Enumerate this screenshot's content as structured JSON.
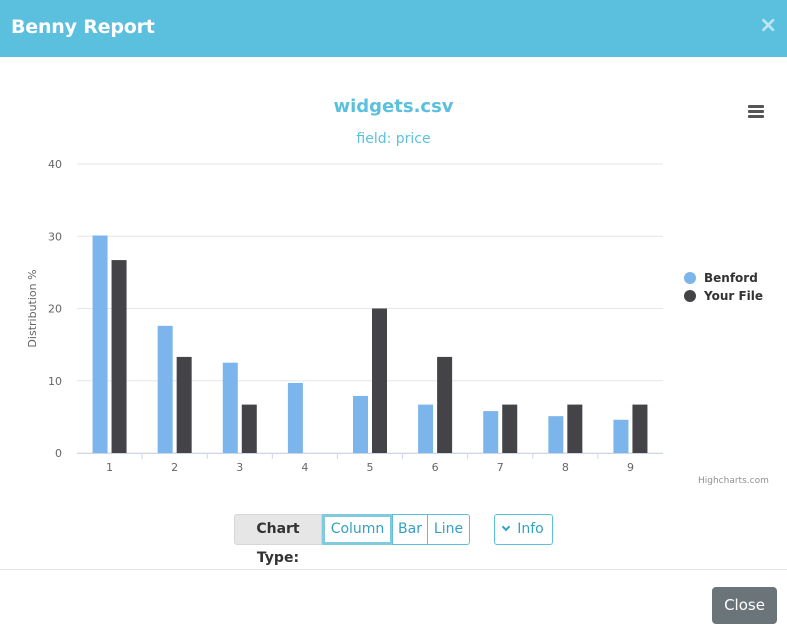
{
  "modal": {
    "title": "Benny Report",
    "close_icon": "×",
    "close_button_label": "Close"
  },
  "controls": {
    "chart_type_label": "Chart Type:",
    "options": [
      "Column",
      "Bar",
      "Line"
    ],
    "selected": "Column",
    "info_label": "Info"
  },
  "credits": "Highcharts.com",
  "colors": {
    "header": "#5bc0de",
    "benford": "#7cb5ec",
    "your_file": "#434348",
    "close_button": "#6b7479"
  },
  "chart_data": {
    "type": "bar",
    "title": "widgets.csv",
    "subtitle": "field: price",
    "xlabel": "",
    "ylabel": "Distribution %",
    "categories": [
      "1",
      "2",
      "3",
      "4",
      "5",
      "6",
      "7",
      "8",
      "9"
    ],
    "series": [
      {
        "name": "Benford",
        "values": [
          30.1,
          17.6,
          12.5,
          9.7,
          7.9,
          6.7,
          5.8,
          5.1,
          4.6
        ]
      },
      {
        "name": "Your File",
        "values": [
          26.7,
          13.3,
          6.7,
          0,
          20,
          13.3,
          6.7,
          6.7,
          6.7
        ]
      }
    ],
    "ylim": [
      0,
      40
    ],
    "yticks": [
      0,
      10,
      20,
      30,
      40
    ],
    "grid": true,
    "legend_position": "right"
  }
}
